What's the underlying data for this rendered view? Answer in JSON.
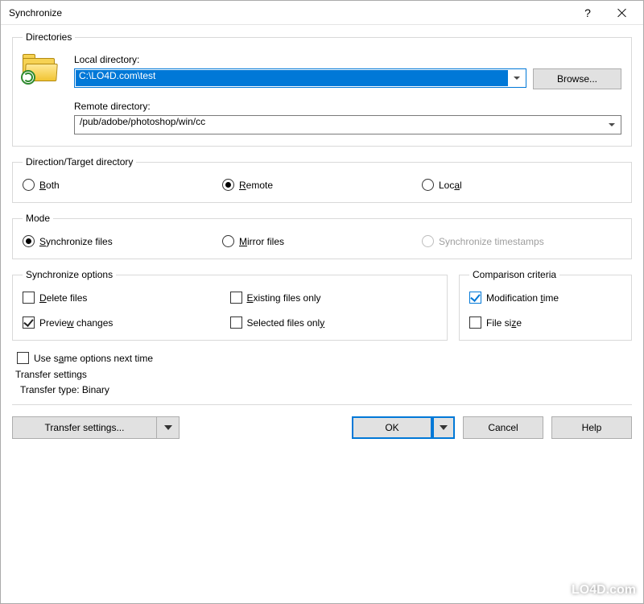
{
  "title": "Synchronize",
  "directories": {
    "legend": "Directories",
    "local_label": "Local directory:",
    "local_value": "C:\\LO4D.com\\test",
    "browse_label": "Browse...",
    "remote_label": "Remote directory:",
    "remote_value": "/pub/adobe/photoshop/win/cc"
  },
  "direction": {
    "legend": "Direction/Target directory",
    "options": {
      "both": "Both",
      "remote": "Remote",
      "local": "Local"
    },
    "selected": "remote"
  },
  "mode": {
    "legend": "Mode",
    "options": {
      "sync": "Synchronize files",
      "mirror": "Mirror files",
      "timestamps": "Synchronize timestamps"
    },
    "selected": "sync",
    "disabled": [
      "timestamps"
    ]
  },
  "sync_options": {
    "legend": "Synchronize options",
    "items": {
      "delete": {
        "label": "Delete files",
        "checked": false
      },
      "existing": {
        "label": "Existing files only",
        "checked": false
      },
      "preview": {
        "label": "Preview changes",
        "checked": true
      },
      "selected": {
        "label": "Selected files only",
        "checked": false
      }
    }
  },
  "comparison": {
    "legend": "Comparison criteria",
    "items": {
      "mtime": {
        "label": "Modification time",
        "checked": true
      },
      "size": {
        "label": "File size",
        "checked": false
      }
    }
  },
  "use_same": {
    "label": "Use same options next time",
    "checked": false
  },
  "transfer": {
    "heading": "Transfer settings",
    "line": "Transfer type: Binary"
  },
  "buttons": {
    "transfer_settings": "Transfer settings...",
    "ok": "OK",
    "cancel": "Cancel",
    "help": "Help"
  },
  "watermark": "LO4D.com"
}
